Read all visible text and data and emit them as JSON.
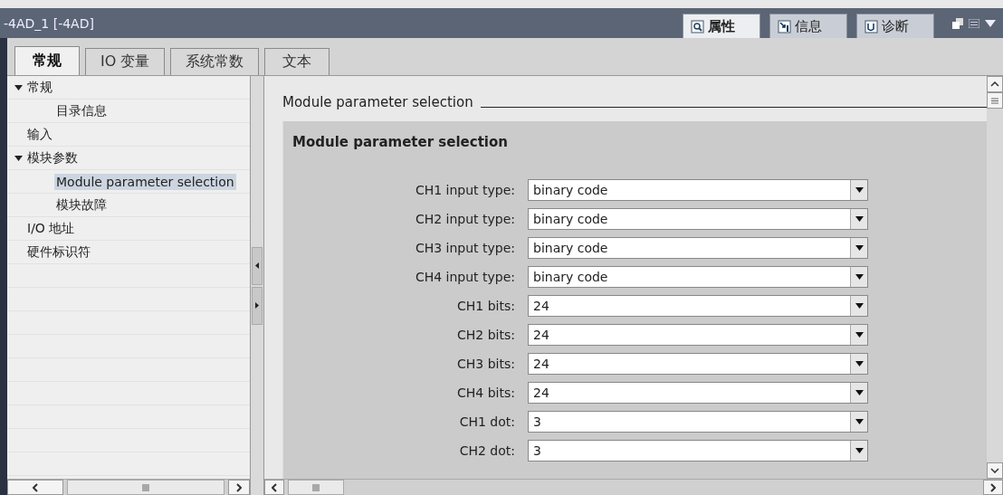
{
  "window": {
    "title": "-4AD_1 [-4AD]"
  },
  "inspector_tabs": [
    {
      "label": "属性",
      "kind": "properties",
      "selected": true
    },
    {
      "label": "信息",
      "kind": "info",
      "selected": false
    },
    {
      "label": "诊断",
      "kind": "diagnostics",
      "selected": false
    }
  ],
  "tabs": [
    {
      "label": "常规",
      "selected": true
    },
    {
      "label": "IO 变量",
      "selected": false
    },
    {
      "label": "系统常数",
      "selected": false
    },
    {
      "label": "文本",
      "selected": false
    }
  ],
  "sidebar": {
    "items": [
      {
        "label": "常规",
        "selected": false,
        "expanded": true,
        "children": [
          {
            "label": "目录信息",
            "selected": false
          }
        ]
      },
      {
        "label": "输入",
        "selected": false
      },
      {
        "label": "模块参数",
        "selected": false,
        "expanded": true,
        "children": [
          {
            "label": "Module parameter selection",
            "selected": true
          },
          {
            "label": "模块故障",
            "selected": false
          }
        ]
      },
      {
        "label": "I/O 地址",
        "selected": false
      },
      {
        "label": "硬件标识符",
        "selected": false
      }
    ]
  },
  "section": {
    "heading": "Module parameter selection",
    "title": "Module parameter selection",
    "fields": [
      {
        "label": "CH1 input type:",
        "value": "binary code"
      },
      {
        "label": "CH2 input type:",
        "value": "binary code"
      },
      {
        "label": "CH3 input type:",
        "value": "binary code"
      },
      {
        "label": "CH4 input type:",
        "value": "binary code"
      },
      {
        "label": "CH1 bits:",
        "value": "24"
      },
      {
        "label": "CH2 bits:",
        "value": "24"
      },
      {
        "label": "CH3 bits:",
        "value": "24"
      },
      {
        "label": "CH4 bits:",
        "value": "24"
      },
      {
        "label": "CH1 dot:",
        "value": "3"
      },
      {
        "label": "CH2 dot:",
        "value": "3"
      }
    ]
  }
}
